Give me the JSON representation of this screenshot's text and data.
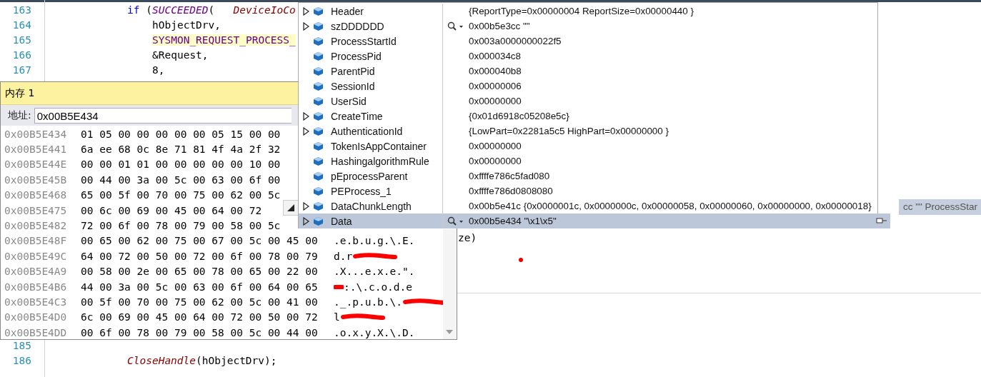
{
  "editor": {
    "top_lines": [
      {
        "number": "163",
        "kind": "statement",
        "code": [
          {
            "kind": "keyword",
            "text": "if"
          },
          {
            "kind": "plain",
            "text": " ("
          },
          {
            "kind": "macro",
            "text": "SUCCEEDED"
          },
          {
            "kind": "plain",
            "text": "(   "
          },
          {
            "kind": "function",
            "text": "DeviceIoCo"
          }
        ],
        "highlighted": false
      },
      {
        "number": "164",
        "kind": "argument",
        "code": [
          {
            "kind": "plain",
            "text": "hObjectDrv,"
          }
        ],
        "highlighted": false
      },
      {
        "number": "165",
        "kind": "argument",
        "code": [
          {
            "kind": "constant",
            "text": "SYSMON_REQUEST_PROCESS_"
          }
        ],
        "highlighted": true
      },
      {
        "number": "166",
        "kind": "argument",
        "code": [
          {
            "kind": "plain",
            "text": "&Request,"
          }
        ],
        "highlighted": false
      },
      {
        "number": "167",
        "kind": "argument",
        "code": [
          {
            "kind": "plain",
            "text": "8,"
          }
        ],
        "highlighted": false
      }
    ],
    "fragment": {
      "code": [
        {
          "kind": "plain",
          "text": "ze)"
        }
      ]
    },
    "bottom_lines": [
      {
        "number": "185"
      },
      {
        "number": "186",
        "kind": "statement",
        "code": [
          {
            "kind": "function",
            "text": "CloseHandle"
          },
          {
            "kind": "plain",
            "text": "(hObjectDrv);"
          }
        ],
        "highlighted": false
      }
    ]
  },
  "memory_window": {
    "title": "内存 1",
    "address_label": "地址:",
    "address": "0x00B5E434",
    "rows": [
      {
        "address": "0x00B5E434",
        "hex": "01 05 00 00 00 00 00 05 15 00 00"
      },
      {
        "address": "0x00B5E441",
        "hex": "6a ee 68 0c 8e 71 81 4f 4a 2f 32"
      },
      {
        "address": "0x00B5E44E",
        "hex": "00 00 01 01 00 00 00 00 00 10 00"
      },
      {
        "address": "0x00B5E45B",
        "hex": "00 44 00 3a 00 5c 00 63 00 6f 00"
      },
      {
        "address": "0x00B5E468",
        "hex": "65 00 5f 00 70 00 75 00 62 00 5c"
      },
      {
        "address": "0x00B5E475",
        "hex": "00 6c 00 69 00 45 00 64 00 72"
      },
      {
        "address": "0x00B5E482",
        "hex": "72 00 6f 00 78 00 79 00 58 00 5c"
      },
      {
        "address": "0x00B5E48F",
        "hex": "00 65 00 62 00 75 00 67 00 5c 00 45 00",
        "ascii": ".e.b.u.g.\\.E."
      },
      {
        "address": "0x00B5E49C",
        "hex": "64 00 72 00 50 00 72 00 6f 00 78 00 79",
        "ascii": "d.r",
        "kind": "tailmarked"
      },
      {
        "address": "0x00B5E4A9",
        "hex": "00 58 00 2e 00 65 00 78 00 65 00 22 00",
        "ascii": ".X...e.x.e.\"."
      },
      {
        "address": "0x00B5E4B6",
        "hex": "44 00 3a 00 5c 00 63 00 6f 00 64 00 65",
        "ascii": ":.\\.c.o.d.e",
        "kind": "headmarked"
      },
      {
        "address": "0x00B5E4C3",
        "hex": "00 5f 00 70 00 75 00 62 00 5c 00 41 00",
        "ascii": "._.p.u.b.\\.",
        "kind": "tailmarked"
      },
      {
        "address": "0x00B5E4D0",
        "hex": "6c 00 69 00 45 00 64 00 72 00 50 00 72",
        "ascii": "l",
        "kind": "tailmarked"
      },
      {
        "address": "0x00B5E4DD",
        "hex": "00 6f 00 78 00 79 00 58 00 5c 00 44 00",
        "ascii": ".o.x.y.X.\\.D."
      }
    ]
  },
  "datatip": {
    "rows": [
      {
        "name": "Header",
        "expandable": true,
        "viewer": false,
        "value": "{ReportType=0x00000004 ReportSize=0x00000440 }",
        "selected": false
      },
      {
        "name": "szDDDDDD",
        "expandable": true,
        "viewer": true,
        "value": "0x00b5e3cc \"\"",
        "selected": false
      },
      {
        "name": "ProcessStartId",
        "expandable": false,
        "viewer": false,
        "value": "0x003a0000000022f5",
        "selected": false
      },
      {
        "name": "ProcessPid",
        "expandable": false,
        "viewer": false,
        "value": "0x000034c8",
        "selected": false
      },
      {
        "name": "ParentPid",
        "expandable": false,
        "viewer": false,
        "value": "0x000040b8",
        "selected": false
      },
      {
        "name": "SessionId",
        "expandable": false,
        "viewer": false,
        "value": "0x00000006",
        "selected": false
      },
      {
        "name": "UserSid",
        "expandable": false,
        "viewer": false,
        "value": "0x00000000",
        "selected": false
      },
      {
        "name": "CreateTime",
        "expandable": true,
        "viewer": false,
        "value": "{0x01d6918c05208e5c}",
        "selected": false
      },
      {
        "name": "AuthenticationId",
        "expandable": true,
        "viewer": false,
        "value": "{LowPart=0x2281a5c5 HighPart=0x00000000 }",
        "selected": false
      },
      {
        "name": "TokenIsAppContainer",
        "expandable": false,
        "viewer": false,
        "value": "0x00000000",
        "selected": false
      },
      {
        "name": "HashingalgorithmRule",
        "expandable": false,
        "viewer": false,
        "value": "0x00000000",
        "selected": false
      },
      {
        "name": "pEprocessParent",
        "expandable": false,
        "viewer": false,
        "value": "0xffffe786c5fad080",
        "selected": false
      },
      {
        "name": "PEProcess_1",
        "expandable": false,
        "viewer": false,
        "value": "0xffffe786d0808080",
        "selected": false
      },
      {
        "name": "DataChunkLength",
        "expandable": true,
        "viewer": false,
        "value": "0x00b5e41c {0x0000001c, 0x0000000c, 0x00000058, 0x00000060, 0x00000000, 0x00000018}",
        "selected": false
      },
      {
        "name": "Data",
        "expandable": true,
        "viewer": true,
        "value": "0x00b5e434 \"\\x1\\x5\"",
        "selected": true
      }
    ]
  },
  "background_tip": {
    "text": "cc \"\" ProcessStar"
  }
}
